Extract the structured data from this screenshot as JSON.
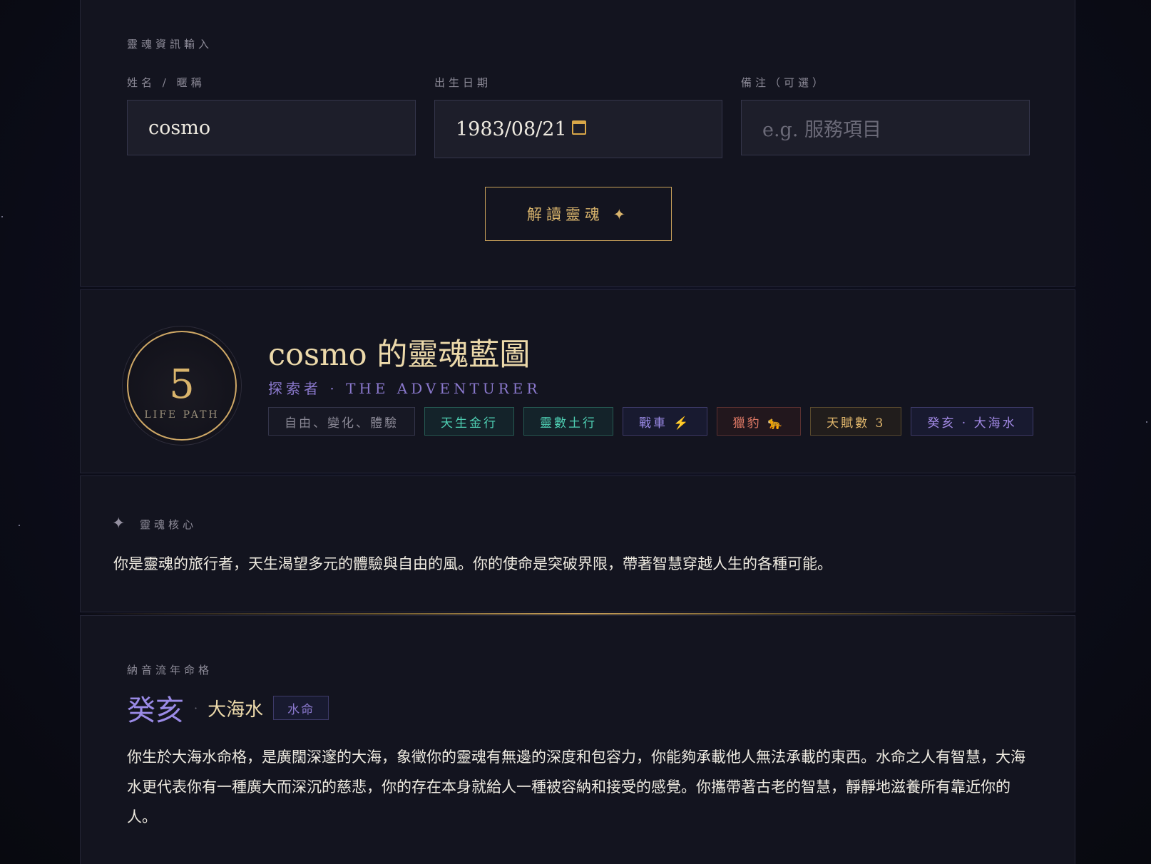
{
  "input_panel": {
    "section_label": "靈魂資訊輸入",
    "name_label": "姓名 / 暱稱",
    "name_value": "cosmo",
    "birth_label": "出生日期",
    "birth_value": "1983/08/21",
    "note_label": "備注（可選）",
    "note_placeholder": "e.g. 服務項目",
    "submit_label": "解讀靈魂 ✦"
  },
  "blueprint": {
    "life_path_number": "5",
    "life_path_caption": "LIFE PATH",
    "title": "cosmo 的靈魂藍圖",
    "subtitle": "探索者 · THE ADVENTURER",
    "tags": [
      {
        "label": "自由、變化、體驗",
        "style": "gray"
      },
      {
        "label": "天生金行",
        "style": "teal"
      },
      {
        "label": "靈數土行",
        "style": "teal"
      },
      {
        "label": "戰車 ⚡",
        "style": "violet"
      },
      {
        "label": "獵豹 🐆",
        "style": "red"
      },
      {
        "label": "天賦數 3",
        "style": "gold"
      },
      {
        "label": "癸亥 · 大海水",
        "style": "purple"
      }
    ]
  },
  "soul_core": {
    "label": "靈魂核心",
    "text": "你是靈魂的旅行者，天生渴望多元的體驗與自由的風。你的使命是突破界限，帶著智慧穿越人生的各種可能。"
  },
  "nayin": {
    "label": "納音流年命格",
    "stem": "癸亥",
    "separator": "·",
    "name": "大海水",
    "badge": "水命",
    "text": "你生於大海水命格，是廣闊深邃的大海，象徵你的靈魂有無邊的深度和包容力，你能夠承載他人無法承載的東西。水命之人有智慧，大海水更代表你有一種廣大而深沉的慈悲，你的存在本身就給人一種被容納和接受的感覺。你攜帶著古老的智慧，靜靜地滋養所有靠近你的人。"
  },
  "colors": {
    "gold_accent": "#c9a15a",
    "violet_accent": "#8a78cc",
    "background": "#0c0d19",
    "panel": "#13141f"
  }
}
